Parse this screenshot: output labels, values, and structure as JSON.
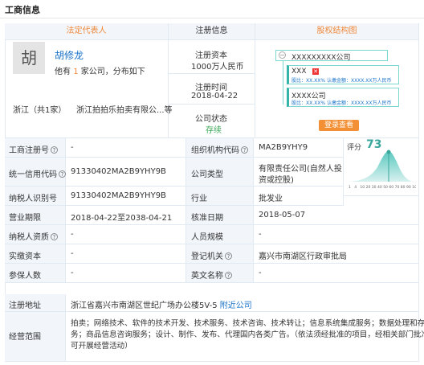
{
  "title": "工商信息",
  "headers": {
    "legal_rep": "法定代表人",
    "reg_info": "注册信息",
    "equity": "股权结构图"
  },
  "person": {
    "avatar_char": "胡",
    "name": "胡修龙",
    "desc_prefix": "他有",
    "count": "1",
    "desc_suffix": "家公司，分布如下",
    "province": "浙江（共1家）",
    "company": "浙江拍拍乐拍卖有限公...等"
  },
  "reg": {
    "capital_label": "注册资本",
    "capital_value": "1000万人民币",
    "time_label": "注册时间",
    "time_value": "2018-04-22",
    "status_label": "公司状态",
    "status_value": "存续"
  },
  "equity": {
    "top_company": "XXXXXXXXX公司",
    "holder1": {
      "name": "XXX",
      "detail": "股比：XX.XX% 认缴金额：XXXX.XX万人民币"
    },
    "holder2": {
      "name": "XXXX公司",
      "detail": "股比：XX.XX% 认缴金额：XXXX.XX万人民币"
    },
    "button": "登录查看"
  },
  "score": {
    "label": "评分",
    "value": "73",
    "axis": [
      "1",
      "4",
      "10",
      "20",
      "30",
      "40",
      "50",
      "60",
      "70",
      "80",
      "90",
      "100"
    ]
  },
  "rows": [
    {
      "l1": "工商注册号",
      "v1": "-",
      "l2": "组织机构代码",
      "v2": "MA2B9YHY9"
    },
    {
      "l1": "统一信用代码",
      "v1": "91330402MA2B9YHY9B",
      "l2": "公司类型",
      "v2a": "有限责任公司(自然人投",
      "v2b": "资或控股)"
    },
    {
      "l1": "纳税人识别号",
      "v1": "91330402MA2B9YHY9B",
      "l2": "行业",
      "v2": "批发业"
    },
    {
      "l1": "营业期限",
      "v1": "2018-04-22至2038-04-21",
      "l2": "核准日期",
      "v2": "2018-05-07"
    },
    {
      "l1": "纳税人资质",
      "v1": "-",
      "l2": "人员规模",
      "v2": "-"
    },
    {
      "l1": "实缴资本",
      "v1": "-",
      "l2": "登记机关",
      "v2": "嘉兴市南湖区行政审批局"
    },
    {
      "l1": "参保人数",
      "v1": "-",
      "l2": "英文名称",
      "v2": "-"
    }
  ],
  "address": {
    "label": "注册地址",
    "value": "浙江省嘉兴市南湖区世纪广场办公楼5V-5",
    "link": "附近公司"
  },
  "scope": {
    "label": "经营范围",
    "line1": "拍卖；网络技术、软件的技术开发、技术服务、技术咨询、技术转让；信息系统集成服务；数据处理和存储服",
    "line2": "务；商品信息咨询服务；设计、制作、发布、代理国内各类广告。（依法须经批准的项目，经相关部门批准后方",
    "line3": "可开展经营活动）"
  }
}
